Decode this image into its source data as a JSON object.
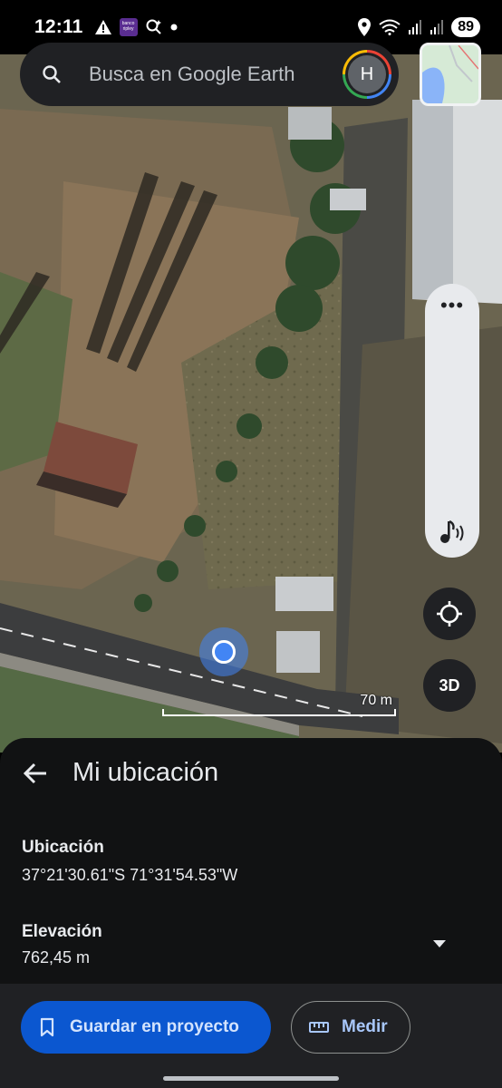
{
  "status_bar": {
    "time": "12:11",
    "battery": "89",
    "notification_badge": "banco ripley",
    "icons": [
      "warning-icon",
      "banco-app-icon",
      "assistant-icon",
      "dot-icon",
      "location-icon",
      "wifi-6-icon",
      "signal-icon",
      "signal-icon"
    ]
  },
  "search": {
    "placeholder": "Busca en Google Earth",
    "avatar_initial": "H"
  },
  "map": {
    "scale_label": "70 m",
    "layer_button_label": "3D"
  },
  "sheet": {
    "title": "Mi ubicación",
    "location_label": "Ubicación",
    "location_value": "37°21'30.61\"S 71°31'54.53\"W",
    "elevation_label": "Elevación",
    "elevation_value": "762,45 m"
  },
  "actions": {
    "save_label": "Guardar en proyecto",
    "measure_label": "Medir"
  },
  "colors": {
    "accent_blue": "#0b57d0",
    "sheet_bg": "#111213",
    "location_dot": "#4285f4"
  }
}
